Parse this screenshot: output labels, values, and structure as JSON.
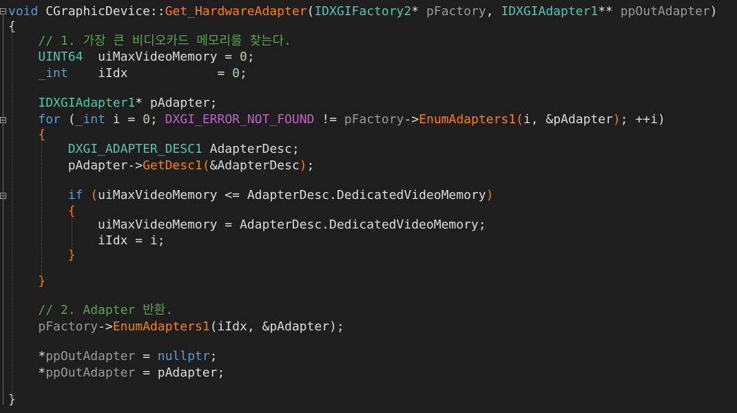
{
  "colors": {
    "keyword": "#569cd6",
    "plain": "#dcdcdc",
    "type": "#4ec9b0",
    "function": "#ff8000",
    "comment": "#57a64a",
    "macro": "#bd63c5",
    "number": "#b5cea8",
    "param": "#9a9a9a",
    "background": "#1e1e1e"
  },
  "code_lines": [
    {
      "segments": [
        {
          "text": "void",
          "style": "keyword"
        },
        {
          "text": " CGraphicDevice::",
          "style": "plain"
        },
        {
          "text": "Get_HardwareAdapter",
          "style": "function"
        },
        {
          "text": "(",
          "style": "plain"
        },
        {
          "text": "IDXGIFactory2",
          "style": "type"
        },
        {
          "text": "* ",
          "style": "plain"
        },
        {
          "text": "pFactory",
          "style": "param"
        },
        {
          "text": ", ",
          "style": "plain"
        },
        {
          "text": "IDXGIAdapter1",
          "style": "type"
        },
        {
          "text": "** ",
          "style": "plain"
        },
        {
          "text": "ppOutAdapter",
          "style": "param"
        },
        {
          "text": ")",
          "style": "plain"
        }
      ]
    },
    {
      "segments": [
        {
          "text": "{",
          "style": "plain"
        }
      ]
    },
    {
      "segments": [
        {
          "text": "    ",
          "style": "plain"
        },
        {
          "text": "// 1. 가장 큰 비디오카드 메모리를 찾는다.",
          "style": "comment"
        }
      ]
    },
    {
      "segments": [
        {
          "text": "    ",
          "style": "plain"
        },
        {
          "text": "UINT64",
          "style": "type"
        },
        {
          "text": "  uiMaxVideoMemory = ",
          "style": "plain"
        },
        {
          "text": "0",
          "style": "number"
        },
        {
          "text": ";",
          "style": "plain"
        }
      ]
    },
    {
      "segments": [
        {
          "text": "    ",
          "style": "plain"
        },
        {
          "text": "_int",
          "style": "keyword"
        },
        {
          "text": "    iIdx            = ",
          "style": "plain"
        },
        {
          "text": "0",
          "style": "number"
        },
        {
          "text": ";",
          "style": "plain"
        }
      ]
    },
    {
      "segments": []
    },
    {
      "segments": [
        {
          "text": "    ",
          "style": "plain"
        },
        {
          "text": "IDXGIAdapter1",
          "style": "type"
        },
        {
          "text": "* pAdapter;",
          "style": "plain"
        }
      ]
    },
    {
      "segments": [
        {
          "text": "    ",
          "style": "plain"
        },
        {
          "text": "for",
          "style": "keyword"
        },
        {
          "text": " (",
          "style": "plain"
        },
        {
          "text": "_int",
          "style": "keyword"
        },
        {
          "text": " i = ",
          "style": "plain"
        },
        {
          "text": "0",
          "style": "number"
        },
        {
          "text": "; ",
          "style": "plain"
        },
        {
          "text": "DXGI_ERROR_NOT_FOUND",
          "style": "macro"
        },
        {
          "text": " != ",
          "style": "plain"
        },
        {
          "text": "pFactory",
          "style": "param"
        },
        {
          "text": "->",
          "style": "plain"
        },
        {
          "text": "EnumAdapters1",
          "style": "function"
        },
        {
          "text": "(",
          "style": "function"
        },
        {
          "text": "i, &pAdapter",
          "style": "plain"
        },
        {
          "text": ")",
          "style": "function"
        },
        {
          "text": "; ++i)",
          "style": "plain"
        }
      ]
    },
    {
      "segments": [
        {
          "text": "    ",
          "style": "plain"
        },
        {
          "text": "{",
          "style": "function"
        }
      ]
    },
    {
      "segments": [
        {
          "text": "        ",
          "style": "plain"
        },
        {
          "text": "DXGI_ADAPTER_DESC1",
          "style": "type"
        },
        {
          "text": " AdapterDesc;",
          "style": "plain"
        }
      ]
    },
    {
      "segments": [
        {
          "text": "        pAdapter->",
          "style": "plain"
        },
        {
          "text": "GetDesc1",
          "style": "function"
        },
        {
          "text": "(",
          "style": "function"
        },
        {
          "text": "&AdapterDesc",
          "style": "plain"
        },
        {
          "text": ")",
          "style": "function"
        },
        {
          "text": ";",
          "style": "plain"
        }
      ]
    },
    {
      "segments": []
    },
    {
      "segments": [
        {
          "text": "        ",
          "style": "plain"
        },
        {
          "text": "if",
          "style": "keyword"
        },
        {
          "text": " ",
          "style": "plain"
        },
        {
          "text": "(",
          "style": "function"
        },
        {
          "text": "uiMaxVideoMemory <= AdapterDesc.DedicatedVideoMemory",
          "style": "plain"
        },
        {
          "text": ")",
          "style": "function"
        }
      ]
    },
    {
      "segments": [
        {
          "text": "        ",
          "style": "plain"
        },
        {
          "text": "{",
          "style": "function"
        }
      ]
    },
    {
      "segments": [
        {
          "text": "            uiMaxVideoMemory = AdapterDesc.DedicatedVideoMemory;",
          "style": "plain"
        }
      ]
    },
    {
      "segments": [
        {
          "text": "            iIdx = i;",
          "style": "plain"
        }
      ]
    },
    {
      "segments": [
        {
          "text": "        ",
          "style": "plain"
        },
        {
          "text": "}",
          "style": "function"
        }
      ]
    },
    {
      "segments": []
    },
    {
      "segments": [
        {
          "text": "    ",
          "style": "plain"
        },
        {
          "text": "}",
          "style": "function"
        }
      ]
    },
    {
      "segments": []
    },
    {
      "segments": [
        {
          "text": "    ",
          "style": "plain"
        },
        {
          "text": "// 2. Adapter 반환.",
          "style": "comment"
        }
      ]
    },
    {
      "segments": [
        {
          "text": "    ",
          "style": "plain"
        },
        {
          "text": "pFactory",
          "style": "param"
        },
        {
          "text": "->",
          "style": "plain"
        },
        {
          "text": "EnumAdapters1",
          "style": "function"
        },
        {
          "text": "(iIdx, &pAdapter);",
          "style": "plain"
        }
      ]
    },
    {
      "segments": []
    },
    {
      "segments": [
        {
          "text": "    *",
          "style": "plain"
        },
        {
          "text": "ppOutAdapter",
          "style": "param"
        },
        {
          "text": " = ",
          "style": "plain"
        },
        {
          "text": "nullptr",
          "style": "keyword"
        },
        {
          "text": ";",
          "style": "plain"
        }
      ]
    },
    {
      "segments": [
        {
          "text": "    *",
          "style": "plain"
        },
        {
          "text": "ppOutAdapter",
          "style": "param"
        },
        {
          "text": " = pAdapter;",
          "style": "plain"
        }
      ]
    },
    {
      "segments": []
    },
    {
      "segments": []
    },
    {
      "segments": [
        {
          "text": "}",
          "style": "plain"
        }
      ]
    }
  ]
}
